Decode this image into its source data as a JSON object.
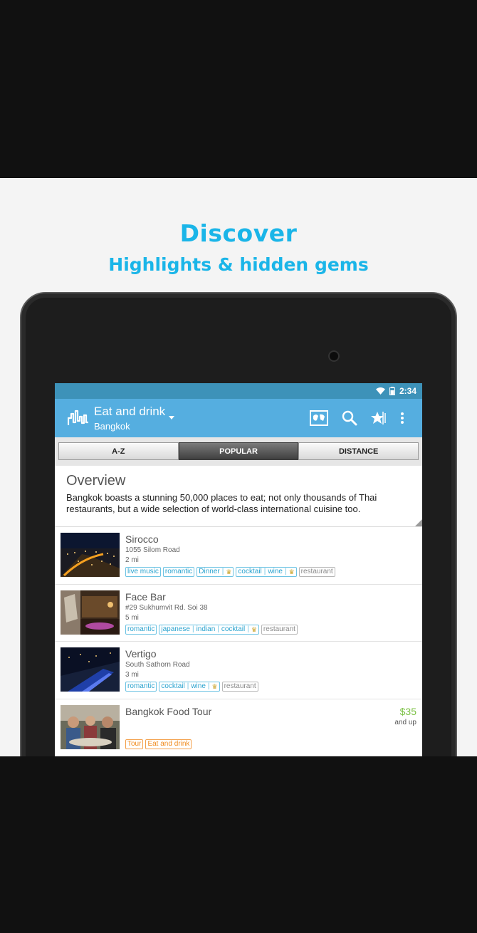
{
  "promo": {
    "headline": "Discover",
    "subline": "Highlights & hidden gems",
    "brand_color": "#1ab5e8"
  },
  "status_bar": {
    "time": "2:34",
    "icons": [
      "wifi-icon",
      "battery-icon"
    ]
  },
  "action_bar": {
    "title": "Eat and drink",
    "subtitle": "Bangkok",
    "color": "#55aee0",
    "icons": [
      "city-skyline-icon",
      "map-icon",
      "search-icon",
      "starred-icon",
      "overflow-menu-icon"
    ]
  },
  "tabs": [
    {
      "label": "A-Z",
      "active": false
    },
    {
      "label": "POPULAR",
      "active": true
    },
    {
      "label": "DISTANCE",
      "active": false
    }
  ],
  "overview": {
    "title": "Overview",
    "text": "Bangkok boasts a stunning 50,000 places to eat; not only thousands of Thai restaurants, but a wide selection of world-class international cuisine too."
  },
  "places": [
    {
      "name": "Sirocco",
      "address": "1055 Silom Road",
      "distance": "2 mi",
      "tags": [
        {
          "parts": [
            "live music"
          ],
          "crown": false,
          "style": "blue"
        },
        {
          "parts": [
            "romantic"
          ],
          "crown": false,
          "style": "blue"
        },
        {
          "parts": [
            "Dinner"
          ],
          "crown": true,
          "style": "blue"
        },
        {
          "parts": [
            "cocktail",
            "wine"
          ],
          "crown": true,
          "style": "blue"
        },
        {
          "parts": [
            "restaurant"
          ],
          "crown": false,
          "style": "grey"
        }
      ]
    },
    {
      "name": "Face Bar",
      "address": "#29 Sukhumvit Rd. Soi 38",
      "distance": "5 mi",
      "tags": [
        {
          "parts": [
            "romantic"
          ],
          "crown": false,
          "style": "blue"
        },
        {
          "parts": [
            "japanese",
            "indian",
            "cocktail"
          ],
          "crown": true,
          "style": "blue"
        },
        {
          "parts": [
            "restaurant"
          ],
          "crown": false,
          "style": "grey"
        }
      ]
    },
    {
      "name": "Vertigo",
      "address": "South Sathorn Road",
      "distance": "3 mi",
      "tags": [
        {
          "parts": [
            "romantic"
          ],
          "crown": false,
          "style": "blue"
        },
        {
          "parts": [
            "cocktail",
            "wine"
          ],
          "crown": true,
          "style": "blue"
        },
        {
          "parts": [
            "restaurant"
          ],
          "crown": false,
          "style": "grey"
        }
      ]
    },
    {
      "name": "Bangkok Food Tour",
      "address": "",
      "distance": "",
      "price": "$35",
      "price_note": "and up",
      "tags": [
        {
          "parts": [
            "Tour"
          ],
          "crown": false,
          "style": "orange"
        },
        {
          "parts": [
            "Eat and drink"
          ],
          "crown": false,
          "style": "orange"
        }
      ]
    }
  ]
}
